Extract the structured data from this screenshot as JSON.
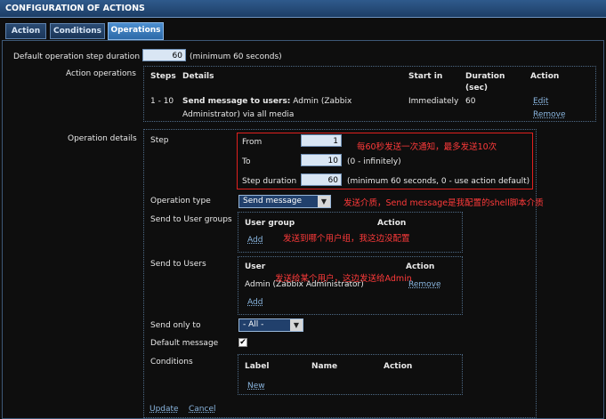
{
  "header": {
    "title": "CONFIGURATION OF ACTIONS"
  },
  "tabs": [
    {
      "label": "Action"
    },
    {
      "label": "Conditions"
    },
    {
      "label": "Operations"
    }
  ],
  "step_duration": {
    "label": "Default operation step duration",
    "value": "60",
    "hint": "(minimum 60 seconds)"
  },
  "action_operations": {
    "label": "Action operations",
    "columns": {
      "steps": "Steps",
      "details": "Details",
      "start_in": "Start in",
      "duration": "Duration",
      "duration_unit": "(sec)",
      "action": "Action"
    },
    "row": {
      "steps": "1 - 10",
      "details_bold": "Send message to users:",
      "details_line1": "Admin (Zabbix",
      "details_line2": "Administrator) via all media",
      "start_in": "Immediately",
      "duration": "60",
      "edit": "Edit",
      "remove": "Remove"
    }
  },
  "operation_details": {
    "label": "Operation details",
    "step": {
      "label": "Step",
      "from_label": "From",
      "from_value": "1",
      "to_label": "To",
      "to_value": "10",
      "to_hint": "(0 - infinitely)",
      "duration_label": "Step duration",
      "duration_value": "60",
      "duration_hint": "(minimum 60 seconds, 0 - use action default)"
    },
    "operation_type": {
      "label": "Operation type",
      "selected": "Send message"
    },
    "user_groups": {
      "label": "Send to User groups",
      "col_group": "User group",
      "col_action": "Action",
      "add": "Add"
    },
    "users": {
      "label": "Send to Users",
      "col_user": "User",
      "col_action": "Action",
      "user": "Admin (Zabbix Administrator)",
      "remove": "Remove",
      "add": "Add"
    },
    "send_only_to": {
      "label": "Send only to",
      "selected": "- All -"
    },
    "default_message": {
      "label": "Default message",
      "checked": "✔"
    },
    "conditions": {
      "label": "Conditions",
      "col_label": "Label",
      "col_name": "Name",
      "col_action": "Action",
      "new": "New"
    },
    "update": "Update",
    "cancel": "Cancel"
  },
  "annotations": {
    "a1": "每60秒发送一次通知，最多发送10次",
    "a2": "发送介质，Send message是我配置的shell脚本介质",
    "a3": "发送到哪个用户组，我这边没配置",
    "a4": "发送给某个用户，这边发送给Admin"
  },
  "colors": {
    "accent": "#2d6aa8",
    "annotation": "#ff3a3a",
    "box_border": "#e0201e"
  }
}
